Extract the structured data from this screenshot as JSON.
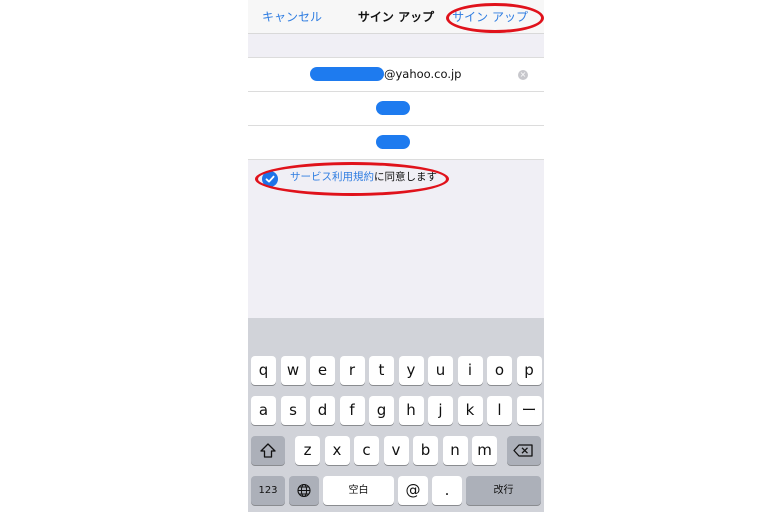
{
  "nav": {
    "cancel": "キャンセル",
    "title": "サイン アップ",
    "signup": "サイン アップ"
  },
  "form": {
    "email_domain": "@yahoo.co.jp",
    "clear_glyph": "×"
  },
  "agree": {
    "terms_link": "サービス利用規約",
    "suffix": "に同意します",
    "checked": true
  },
  "keyboard": {
    "row1": [
      "q",
      "w",
      "e",
      "r",
      "t",
      "y",
      "u",
      "i",
      "o",
      "p"
    ],
    "row2": [
      "a",
      "s",
      "d",
      "f",
      "g",
      "h",
      "j",
      "k",
      "l",
      "ー"
    ],
    "row3": [
      "z",
      "x",
      "c",
      "v",
      "b",
      "n",
      "m"
    ],
    "numbers_key": "123",
    "space_key": "空白",
    "at_key": "@",
    "period_key": ".",
    "return_key": "改行"
  },
  "colors": {
    "accent": "#2f7de1",
    "annotation": "#e0121b",
    "redaction": "#1e7bef"
  }
}
